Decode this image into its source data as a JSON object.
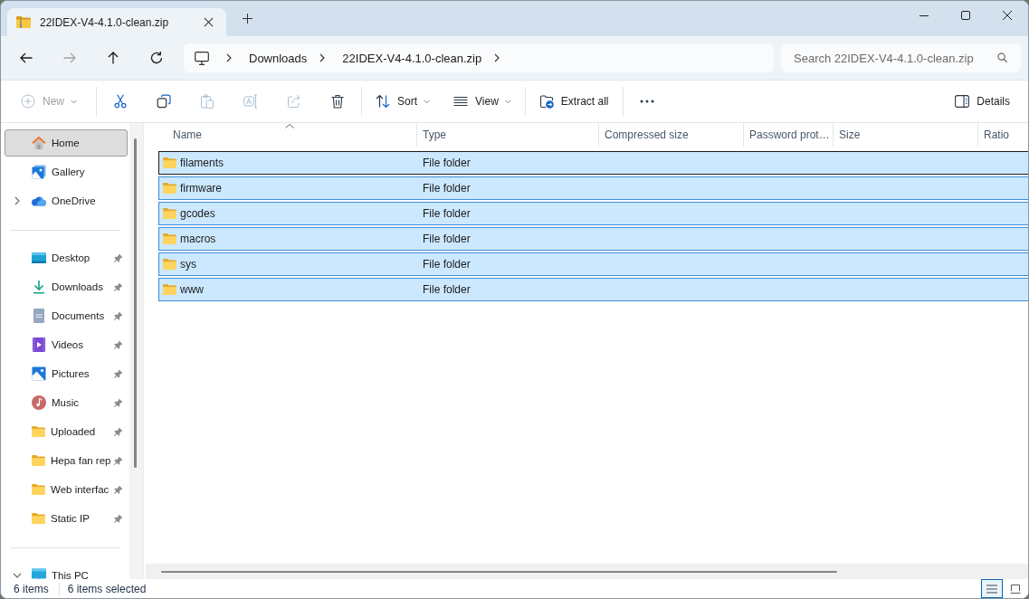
{
  "tabs": [
    {
      "title": "22IDEX-V4-4.1.0-clean.zip",
      "selected": true
    }
  ],
  "navigation": [
    {
      "kind": "back",
      "disabled": false
    },
    {
      "kind": "forward",
      "disabled": true
    },
    {
      "kind": "up",
      "disabled": false
    },
    {
      "kind": "refresh",
      "disabled": false
    }
  ],
  "address": {
    "segments": [
      "Downloads",
      "22IDEX-V4-4.1.0-clean.zip"
    ]
  },
  "search": {
    "placeholder": "Search 22IDEX-V4-4.1.0-clean.zip"
  },
  "toolbar": {
    "groups": [
      [
        {
          "kind": "new",
          "label": "New",
          "disabled": true,
          "dropdown": true
        }
      ],
      [
        {
          "kind": "cut",
          "disabled": false
        },
        {
          "kind": "copy",
          "disabled": false
        },
        {
          "kind": "paste",
          "disabled": true
        },
        {
          "kind": "rename",
          "disabled": true
        },
        {
          "kind": "share",
          "disabled": true
        },
        {
          "kind": "delete",
          "disabled": false
        }
      ],
      [
        {
          "kind": "sort",
          "label": "Sort",
          "disabled": false,
          "dropdown": true
        },
        {
          "kind": "view",
          "label": "View",
          "disabled": false,
          "dropdown": true
        }
      ],
      [
        {
          "kind": "extract",
          "label": "Extract all",
          "disabled": false,
          "dropdown": false
        }
      ],
      [
        {
          "kind": "more",
          "disabled": false
        }
      ]
    ],
    "details": {
      "label": "Details"
    }
  },
  "sidebar": {
    "groups": [
      {
        "items": [
          {
            "kind": "home",
            "label": "Home",
            "selected": true,
            "pinned": false,
            "expandable": false
          },
          {
            "kind": "gallery",
            "label": "Gallery",
            "selected": false,
            "pinned": false,
            "expandable": false
          },
          {
            "kind": "cloud",
            "label": "OneDrive",
            "selected": false,
            "pinned": false,
            "expandable": true,
            "expanded": false
          }
        ]
      },
      {
        "items": [
          {
            "kind": "desktop",
            "label": "Desktop",
            "selected": false,
            "pinned": true,
            "expandable": false
          },
          {
            "kind": "downloads",
            "label": "Downloads",
            "selected": false,
            "pinned": true,
            "expandable": false
          },
          {
            "kind": "documents",
            "label": "Documents",
            "selected": false,
            "pinned": true,
            "expandable": false
          },
          {
            "kind": "videos",
            "label": "Videos",
            "selected": false,
            "pinned": true,
            "expandable": false
          },
          {
            "kind": "pictures",
            "label": "Pictures",
            "selected": false,
            "pinned": true,
            "expandable": false
          },
          {
            "kind": "music",
            "label": "Music",
            "selected": false,
            "pinned": true,
            "expandable": false
          },
          {
            "kind": "folder",
            "label": "Uploaded",
            "selected": false,
            "pinned": true,
            "expandable": false
          },
          {
            "kind": "folder",
            "label": "Hepa fan rep",
            "selected": false,
            "pinned": true,
            "expandable": false
          },
          {
            "kind": "folder",
            "label": "Web interfac",
            "selected": false,
            "pinned": true,
            "expandable": false
          },
          {
            "kind": "folder",
            "label": "Static IP",
            "selected": false,
            "pinned": true,
            "expandable": false
          }
        ]
      },
      {
        "items": [
          {
            "kind": "computer",
            "label": "This PC",
            "selected": false,
            "pinned": false,
            "expandable": true,
            "expanded": true
          }
        ]
      }
    ]
  },
  "table": {
    "columns": [
      {
        "label": "Name",
        "sorted": true
      },
      {
        "label": "Type",
        "sorted": false
      },
      {
        "label": "Compressed size",
        "sorted": false
      },
      {
        "label": "Password prot…",
        "sorted": false
      },
      {
        "label": "Size",
        "sorted": false
      },
      {
        "label": "Ratio",
        "sorted": false
      }
    ],
    "rows": [
      {
        "name": "filaments",
        "type": "File folder",
        "selected": true,
        "focused": true
      },
      {
        "name": "firmware",
        "type": "File folder",
        "selected": true,
        "focused": false
      },
      {
        "name": "gcodes",
        "type": "File folder",
        "selected": true,
        "focused": false
      },
      {
        "name": "macros",
        "type": "File folder",
        "selected": true,
        "focused": false
      },
      {
        "name": "sys",
        "type": "File folder",
        "selected": true,
        "focused": false
      },
      {
        "name": "www",
        "type": "File folder",
        "selected": true,
        "focused": false
      }
    ]
  },
  "status_bar": {
    "item_count": "6 items",
    "selection": "6 items selected",
    "views": [
      {
        "kind": "details",
        "selected": true
      },
      {
        "kind": "tiles",
        "selected": false
      }
    ]
  }
}
